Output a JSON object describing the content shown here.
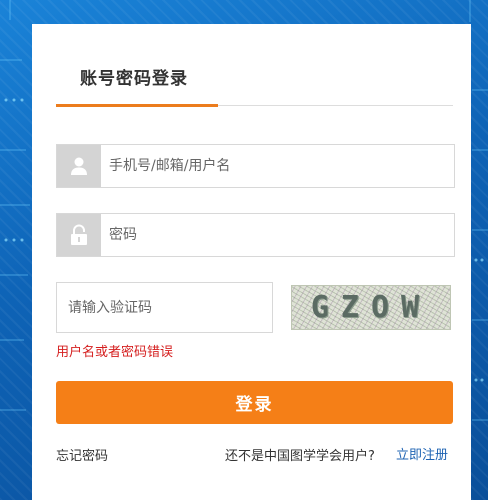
{
  "login": {
    "tab_title": "账号密码登录",
    "username_placeholder": "手机号/邮箱/用户名",
    "password_placeholder": "密码",
    "captcha_placeholder": "请输入验证码",
    "captcha_text": "GZOW",
    "error_message": "用户名或者密码错误",
    "submit_label": "登录",
    "forgot_password": "忘记密码",
    "not_member_text": "还不是中国图学学会用户?",
    "register_link": "立即注册"
  },
  "colors": {
    "accent": "#f57f17",
    "tab_underline": "#ec7c1d",
    "error": "#d51f1f",
    "link": "#1e63b3",
    "background": "#0e63b6"
  }
}
